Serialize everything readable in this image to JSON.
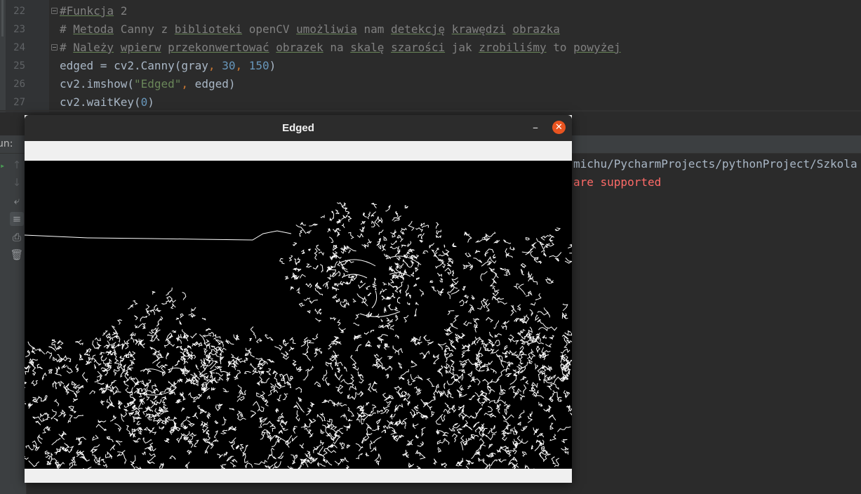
{
  "editor": {
    "lines": [
      {
        "no": "22",
        "text": "#Funkcja 2"
      },
      {
        "no": "23",
        "text": "# Metoda Canny z biblioteki openCV umożliwia nam detekcję krawędzi obrazka"
      },
      {
        "no": "24",
        "text": "# Należy wpierw przekonwertować obrazek na skalę szarości jak zrobiliśmy to powyżej"
      },
      {
        "no": "25",
        "text": "edged = cv2.Canny(gray, 30, 150)"
      },
      {
        "no": "26",
        "text": "cv2.imshow(\"Edged\", edged)"
      },
      {
        "no": "27",
        "text": "cv2.waitKey(0)"
      }
    ]
  },
  "run_panel": {
    "label": "un:",
    "console_path": "michu/PycharmProjects/pythonProject/Szkola",
    "console_error": "are supported",
    "buttons": [
      "arrow-up-icon",
      "arrow-down-icon",
      "soft-wrap-icon",
      "scroll-to-end-icon",
      "print-icon",
      "trash-icon"
    ]
  },
  "cv_window": {
    "title": "Edged",
    "minimize_glyph": "–",
    "close_glyph": "✕",
    "image_description_icon": "canny-edge-image"
  },
  "colors": {
    "editor_bg": "#2b2b2b",
    "comment": "#808080",
    "number": "#6897bb",
    "string": "#6a8759",
    "error": "#ff6b68",
    "close_button": "#e95420"
  }
}
